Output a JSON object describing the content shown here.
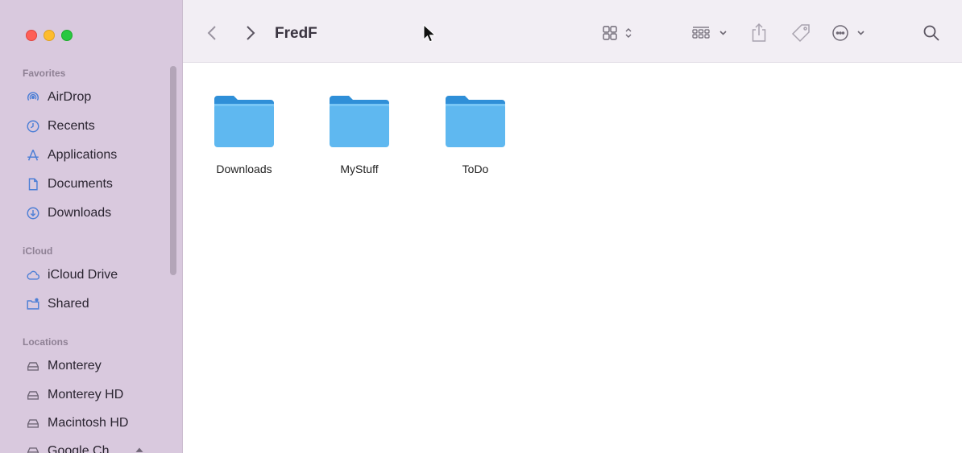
{
  "window": {
    "title": "FredF"
  },
  "sidebar": {
    "sections": [
      {
        "title": "Favorites"
      },
      {
        "title": "iCloud"
      },
      {
        "title": "Locations"
      }
    ],
    "favorites": [
      {
        "label": "AirDrop",
        "icon": "airdrop-icon"
      },
      {
        "label": "Recents",
        "icon": "clock-icon"
      },
      {
        "label": "Applications",
        "icon": "applications-icon"
      },
      {
        "label": "Documents",
        "icon": "document-icon"
      },
      {
        "label": "Downloads",
        "icon": "download-icon"
      }
    ],
    "icloud": [
      {
        "label": "iCloud Drive",
        "icon": "cloud-icon"
      },
      {
        "label": "Shared",
        "icon": "shared-folder-icon"
      }
    ],
    "locations": [
      {
        "label": "Monterey",
        "icon": "disk-icon"
      },
      {
        "label": "Monterey HD",
        "icon": "disk-icon"
      },
      {
        "label": "Macintosh HD",
        "icon": "disk-icon"
      },
      {
        "label": "Google Ch...",
        "icon": "disk-icon"
      }
    ]
  },
  "toolbar": {
    "icons": [
      "back-chevron-icon",
      "forward-chevron-icon",
      "grid-view-icon",
      "group-icon",
      "share-icon",
      "tag-icon",
      "more-icon",
      "search-icon"
    ]
  },
  "files": [
    {
      "name": "Downloads"
    },
    {
      "name": "MyStuff"
    },
    {
      "name": "ToDo"
    }
  ],
  "colors": {
    "sidebar": "#d9c9de",
    "toolbar": "#f2eef4",
    "folder": "#5fb8f0",
    "folder_tab": "#2f8fd8",
    "accent": "#4d7fd6"
  }
}
